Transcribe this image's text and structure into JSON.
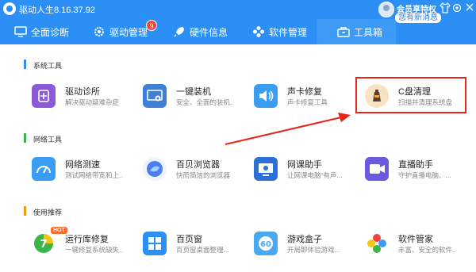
{
  "window": {
    "title": "驱动人生8.16.37.92",
    "vip_label": "会员享特权",
    "message_badge": "您有新消息"
  },
  "nav": {
    "tabs": [
      {
        "label": "全面诊断",
        "icon": "monitor-icon"
      },
      {
        "label": "驱动管理",
        "icon": "gear-icon",
        "badge": "9"
      },
      {
        "label": "硬件信息",
        "icon": "rocket-icon"
      },
      {
        "label": "软件管理",
        "icon": "apps-icon"
      },
      {
        "label": "工具箱",
        "icon": "toolbox-icon",
        "active": true
      }
    ]
  },
  "sections": [
    {
      "title": "系统工具",
      "color": "#2c8ff5",
      "tools": [
        {
          "name": "驱动诊所",
          "desc": "解决驱动疑难杂症",
          "icon": "driver-clinic-icon"
        },
        {
          "name": "一键装机",
          "desc": "安全、全面的装机...",
          "icon": "one-click-install-icon"
        },
        {
          "name": "声卡修复",
          "desc": "声卡修复工具",
          "icon": "sound-card-icon"
        },
        {
          "name": "C盘清理",
          "desc": "扫描并清理系统盘",
          "icon": "c-drive-clean-icon"
        }
      ]
    },
    {
      "title": "网络工具",
      "color": "#3bb54a",
      "tools": [
        {
          "name": "网络测速",
          "desc": "测试网络带宽和上...",
          "icon": "speed-test-icon"
        },
        {
          "name": "百贝浏览器",
          "desc": "快而简洁的浏览器",
          "icon": "browser-icon"
        },
        {
          "name": "网课助手",
          "desc": "让网课电脑“有声...",
          "icon": "online-class-icon"
        },
        {
          "name": "直播助手",
          "desc": "守护直播电脑、...",
          "icon": "live-stream-icon"
        }
      ]
    },
    {
      "title": "使用推荐",
      "color": "#f59b1c",
      "tools": [
        {
          "name": "运行库修复",
          "desc": "一键修复系统缺失...",
          "icon": "runtime-repair-icon",
          "tag": "HOT"
        },
        {
          "name": "百页窗",
          "desc": "百页窗桌面整理...",
          "icon": "desktop-organizer-icon"
        },
        {
          "name": "游戏盒子",
          "desc": "开局即体验游戏...",
          "icon": "game-box-icon"
        },
        {
          "name": "软件管家",
          "desc": "丰富、安全的软件...",
          "icon": "software-manager-icon"
        }
      ]
    }
  ]
}
